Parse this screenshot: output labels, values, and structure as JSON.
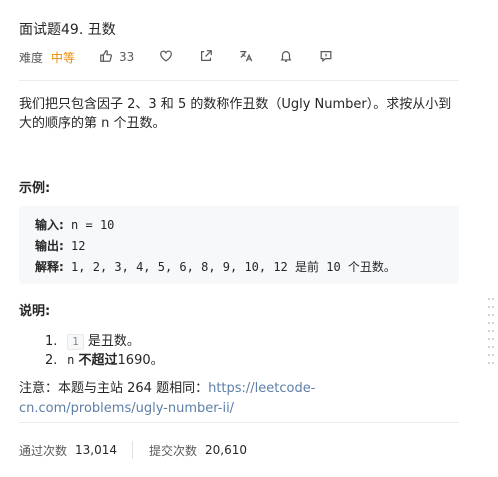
{
  "problem": {
    "title": "面试题49. 丑数",
    "difficulty_label": "难度",
    "difficulty": "中等",
    "likes": "33"
  },
  "actions": [
    {
      "icon": "thumbs-up-icon"
    },
    {
      "icon": "heart-icon"
    },
    {
      "icon": "share-icon"
    },
    {
      "icon": "translate-icon"
    },
    {
      "icon": "bell-icon"
    },
    {
      "icon": "comment-icon"
    }
  ],
  "description": {
    "text": "我们把只包含因子 2、3 和 5 的数称作丑数（Ugly Number）。求按从小到大的顺序的第 n 个丑数。"
  },
  "example": {
    "heading": "示例:",
    "input_label": "输入:",
    "input_value": "n = 10",
    "output_label": "输出:",
    "output_value": "12",
    "explain_label": "解释:",
    "explain_value": "1, 2, 3, 4, 5, 6, 8, 9, 10, 12 是前 10 个丑数。"
  },
  "notes": {
    "heading": "说明:",
    "items": [
      {
        "num": "1.",
        "code": "1",
        "text": "是丑数。"
      },
      {
        "num": "2.",
        "code": "n",
        "bold": "不超过",
        "text": "1690。"
      }
    ]
  },
  "footer_note": {
    "prefix": "注意：本题与主站 264 题相同：",
    "link": "https://leetcode-cn.com/problems/ugly-number-ii/"
  },
  "stats": {
    "accepted_label": "通过次数",
    "accepted_value": "13,014",
    "submissions_label": "提交次数",
    "submissions_value": "20,610"
  },
  "colors": {
    "difficulty": "#ef8b00",
    "link": "#5d7ea7",
    "code_bg": "#f7f8fa"
  }
}
